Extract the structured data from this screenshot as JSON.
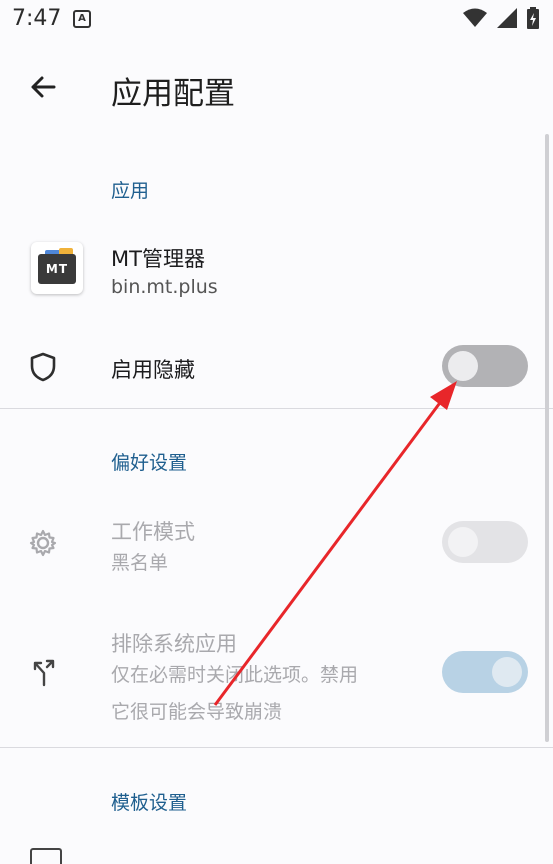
{
  "status_bar": {
    "time": "7:47",
    "notification_icon": "A"
  },
  "app_bar": {
    "title": "应用配置"
  },
  "sections": {
    "app": "应用",
    "preferences": "偏好设置",
    "template": "模板设置"
  },
  "app_info": {
    "name": "MT管理器",
    "package": "bin.mt.plus",
    "icon_label": "MT"
  },
  "enable_hide": {
    "label": "启用隐藏",
    "enabled": false
  },
  "work_mode": {
    "label": "工作模式",
    "value": "黑名单",
    "enabled": false
  },
  "exclude_system": {
    "label": "排除系统应用",
    "description_line1": "仅在必需时关闭此选项。禁用",
    "description_line2": "它很可能会导致崩溃",
    "enabled": true
  },
  "colors": {
    "accent": "#1f5f8f",
    "switch_off": "#b5b5b8",
    "switch_on_disabled": "#b9d3e6",
    "arrow": "#e8262a"
  }
}
